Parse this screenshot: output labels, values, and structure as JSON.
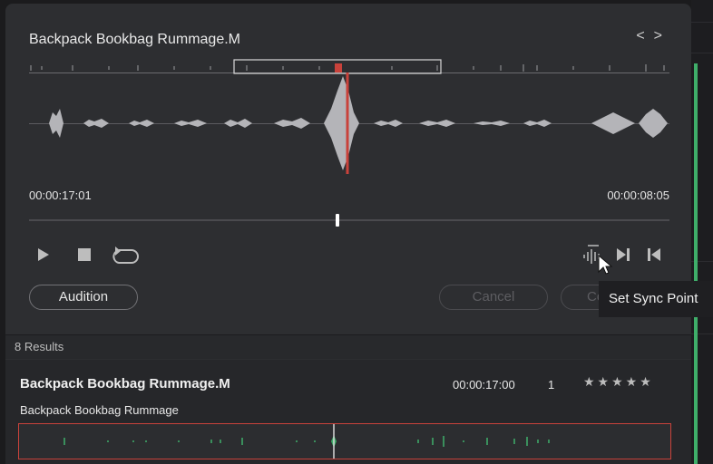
{
  "clip_title": "Backpack Bookbag Rummage.M",
  "nav": {
    "prev": "<",
    "next": ">"
  },
  "time_start": "00:00:17:01",
  "time_end": "00:00:08:05",
  "playhead_fraction": 0.48,
  "buttons": {
    "audition": "Audition",
    "cancel": "Cancel",
    "confirm_partial": "Co"
  },
  "tooltip": "Set Sync Point",
  "results_count": "8 Results",
  "result": {
    "title": "Backpack Bookbag Rummage.M",
    "subtitle": "Backpack Bookbag Rummage",
    "timecode": "00:00:17:00",
    "channel": "1",
    "stars": "★★★★★"
  },
  "icons": {
    "play": "play-icon",
    "stop": "stop-icon",
    "loop": "loop-icon",
    "sync": "sync-point-icon",
    "jump_end": "jump-to-end-icon",
    "jump_start": "jump-to-start-icon",
    "cursor": "cursor-icon"
  },
  "colors": {
    "panel": "#2d2e31",
    "waveform": "#b4b4b8",
    "playhead": "#c9423b",
    "result_wave": "#3fae6a",
    "accent_track": "#3fae6a"
  }
}
